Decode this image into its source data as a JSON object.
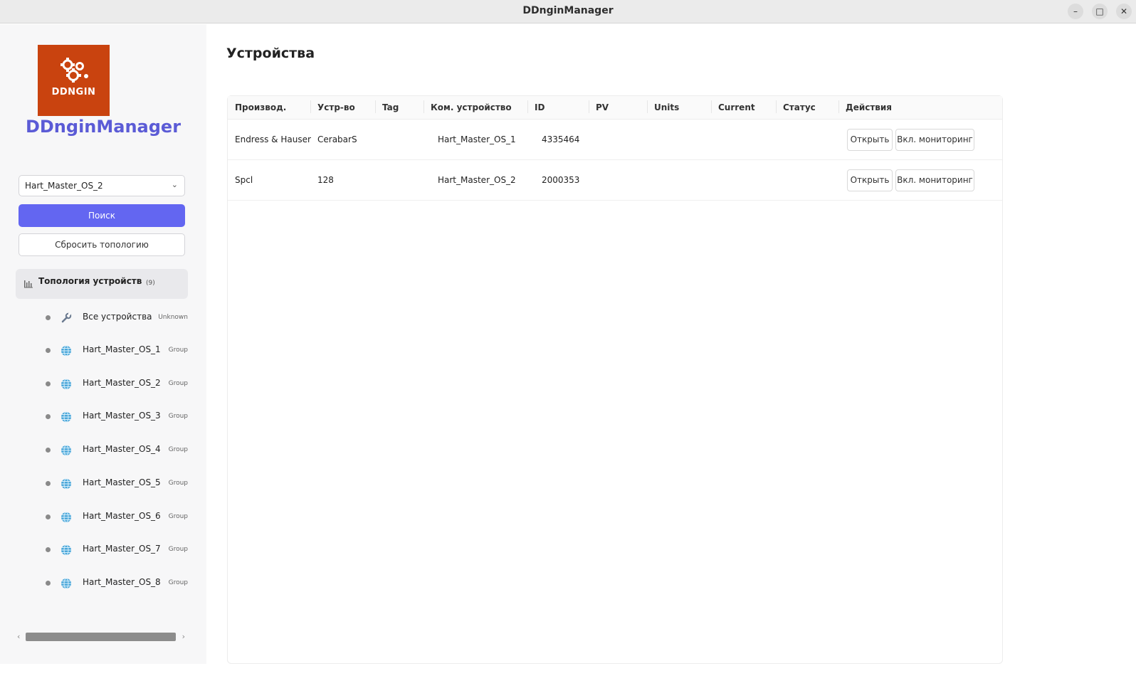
{
  "window": {
    "title": "DDnginManager",
    "minimize": "–",
    "maximize": "□",
    "close": "✕"
  },
  "sidebar": {
    "logo_text": "DDNGIN",
    "app_name": "DDnginManager",
    "selected_master": "Hart_Master_OS_2",
    "search_button": "Поиск",
    "reset_button": "Сбросить топологию",
    "tree": {
      "title": "Топология устройств",
      "count": "(9)",
      "items": [
        {
          "label": "Все устройства",
          "type": "Unknown",
          "icon": "wrench-icon"
        },
        {
          "label": "Hart_Master_OS_1",
          "type": "Group",
          "icon": "globe-icon"
        },
        {
          "label": "Hart_Master_OS_2",
          "type": "Group",
          "icon": "globe-icon"
        },
        {
          "label": "Hart_Master_OS_3",
          "type": "Group",
          "icon": "globe-icon"
        },
        {
          "label": "Hart_Master_OS_4",
          "type": "Group",
          "icon": "globe-icon"
        },
        {
          "label": "Hart_Master_OS_5",
          "type": "Group",
          "icon": "globe-icon"
        },
        {
          "label": "Hart_Master_OS_6",
          "type": "Group",
          "icon": "globe-icon"
        },
        {
          "label": "Hart_Master_OS_7",
          "type": "Group",
          "icon": "globe-icon"
        },
        {
          "label": "Hart_Master_OS_8",
          "type": "Group",
          "icon": "globe-icon"
        }
      ]
    }
  },
  "main": {
    "title": "Устройства",
    "table": {
      "columns": [
        "Производ.",
        "Устр-во",
        "Tag",
        "Ком. устройство",
        "ID",
        "PV",
        "Units",
        "Current",
        "Статус",
        "Действия"
      ],
      "rows": [
        {
          "manufacturer": "Endress & Hauser",
          "device": "CerabarS",
          "tag": "",
          "com_device": "Hart_Master_OS_1",
          "id": "4335464",
          "pv": "",
          "units": "",
          "current": "",
          "status": ""
        },
        {
          "manufacturer": "Spcl",
          "device": "128",
          "tag": "",
          "com_device": "Hart_Master_OS_2",
          "id": "2000353",
          "pv": "",
          "units": "",
          "current": "",
          "status": ""
        }
      ],
      "open_label": "Открыть",
      "monitor_label": "Вкл. мониторинг"
    }
  },
  "colors": {
    "accent": "#6366f1",
    "logo_bg": "#c9430f",
    "app_name": "#5b5bd6"
  }
}
